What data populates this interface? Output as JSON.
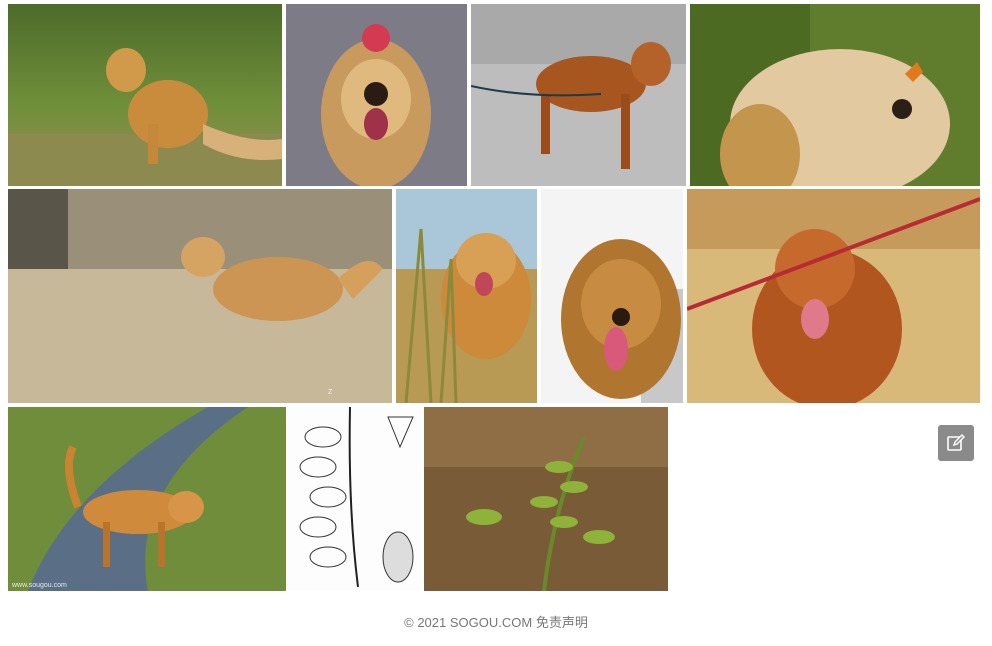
{
  "gallery": {
    "images": [
      {
        "name": "image-dog-sitting-grass"
      },
      {
        "name": "image-dog-flower-hat"
      },
      {
        "name": "image-dog-on-leash-street"
      },
      {
        "name": "image-dog-butterfly-nose"
      },
      {
        "name": "image-dog-running-dirt"
      },
      {
        "name": "image-dog-in-grass-smiling"
      },
      {
        "name": "image-dog-sunlight-tongue"
      },
      {
        "name": "image-cocker-spaniel"
      },
      {
        "name": "image-dog-walking-path"
      },
      {
        "name": "image-botanical-sketch"
      },
      {
        "name": "image-fern-plant"
      }
    ]
  },
  "feedback": {
    "icon": "edit-icon"
  },
  "footer": {
    "copyright": "© 2021 SOGOU.COM",
    "disclaimer": "免责声明"
  }
}
